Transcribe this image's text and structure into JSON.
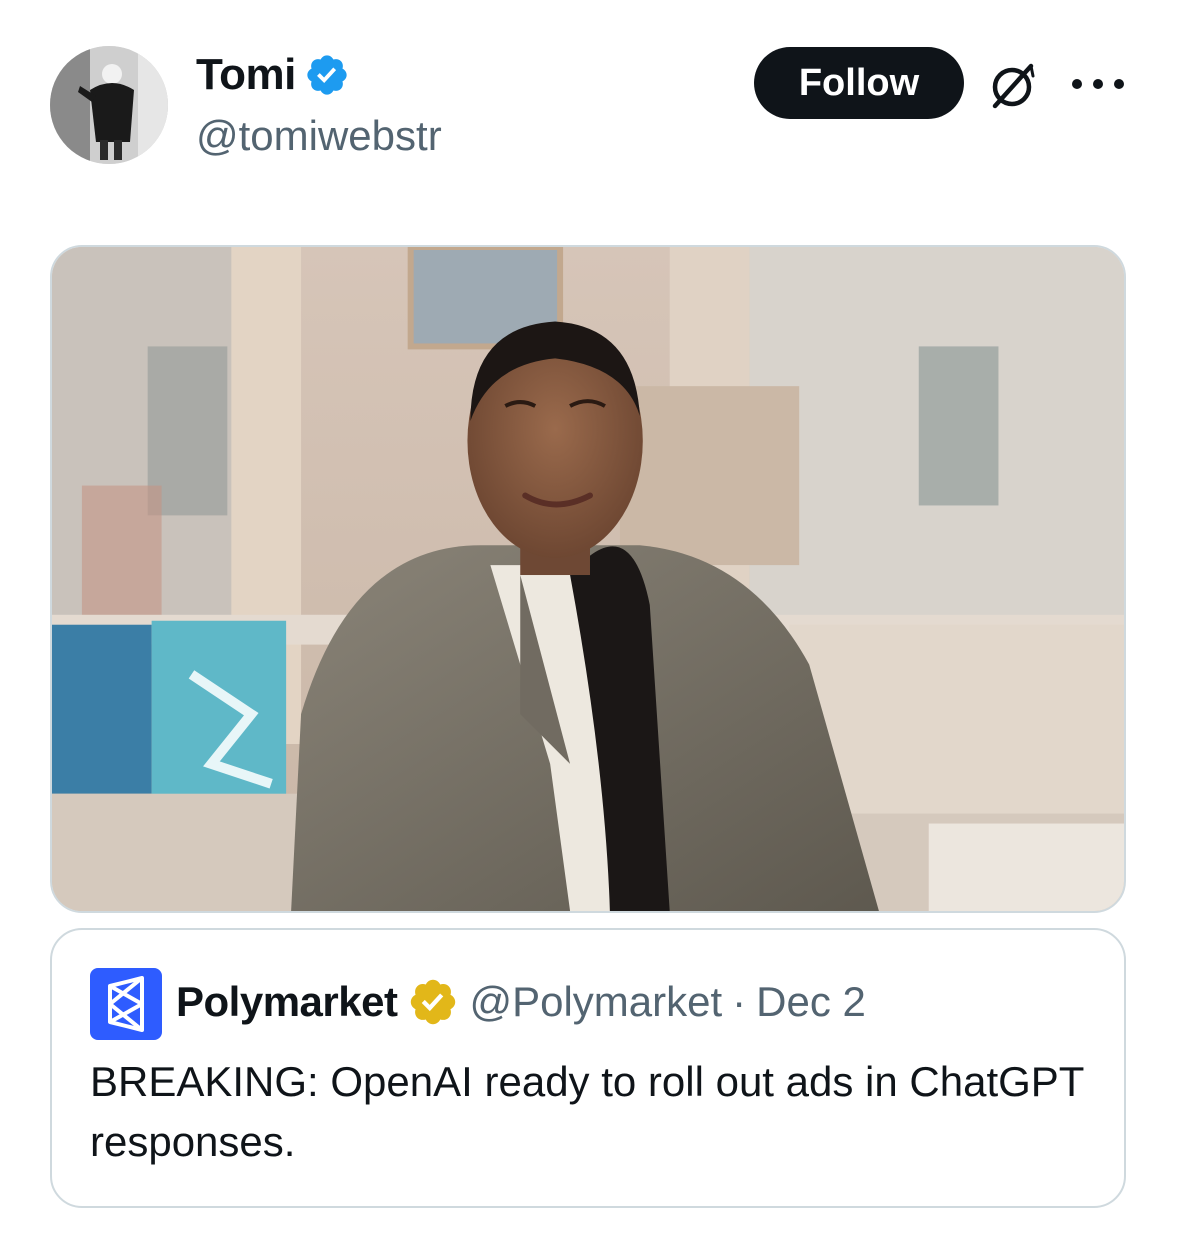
{
  "author": {
    "display_name": "Tomi",
    "handle": "@tomiwebstr",
    "verified_icon": "verified-blue-badge-icon"
  },
  "actions": {
    "follow_label": "Follow",
    "grok_icon": "grok-icon",
    "more_icon": "more-icon"
  },
  "media": {
    "kind": "photo"
  },
  "quoted": {
    "display_name": "Polymarket",
    "handle": "@Polymarket",
    "separator": "·",
    "date": "Dec 2",
    "badge_icon": "verified-gold-badge-icon",
    "text": "BREAKING: OpenAI ready to roll out ads in ChatGPT responses."
  },
  "colors": {
    "follow_bg": "#0f1419",
    "verified_blue": "#1d9bf0",
    "verified_gold": "#e2b719",
    "polymarket_blue": "#2e5cff",
    "secondary_text": "#536471",
    "border": "#cfd9de"
  }
}
